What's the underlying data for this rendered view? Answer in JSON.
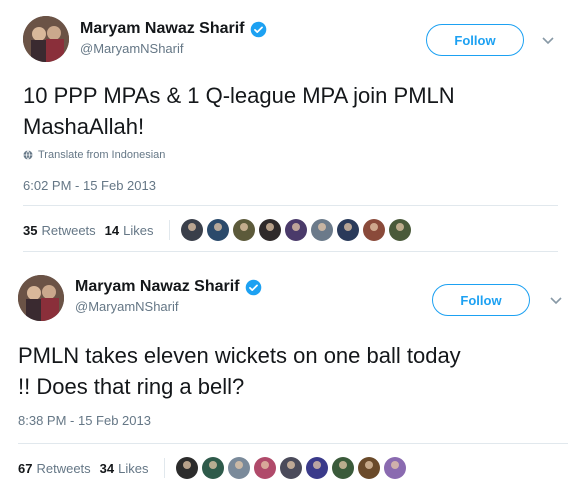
{
  "tweets": [
    {
      "author": {
        "name": "Maryam Nawaz Sharif",
        "handle": "@MaryamNSharif",
        "verified": true
      },
      "follow_label": "Follow",
      "text": "10 PPP MPAs & 1 Q-league MPA join PMLN\nMashaAllah!",
      "translate_label": "Translate from Indonesian",
      "timestamp": "6:02 PM - 15 Feb 2013",
      "retweets": {
        "count": "35",
        "label": "Retweets"
      },
      "likes": {
        "count": "14",
        "label": "Likes"
      },
      "liker_colors": [
        "#3a3f4a",
        "#2b4a6b",
        "#5c5a3a",
        "#2f2a2a",
        "#4a3a6a",
        "#6b7a8a",
        "#2a3a5a",
        "#8a4a3a",
        "#4a5a3a"
      ]
    },
    {
      "author": {
        "name": "Maryam Nawaz Sharif",
        "handle": "@MaryamNSharif",
        "verified": true
      },
      "follow_label": "Follow",
      "text": "PMLN takes eleven wickets on one ball today\n!! Does that ring a bell?",
      "timestamp": "8:38 PM - 15 Feb 2013",
      "retweets": {
        "count": "67",
        "label": "Retweets"
      },
      "likes": {
        "count": "34",
        "label": "Likes"
      },
      "liker_colors": [
        "#2c2c2c",
        "#2e5a4a",
        "#7a8a9a",
        "#b04a6a",
        "#4a4a5a",
        "#3a3a8a",
        "#3a5a3a",
        "#6a4a2a",
        "#8a6ab0"
      ]
    }
  ],
  "colors": {
    "accent": "#1da1f2",
    "muted": "#657786",
    "text": "#14171a",
    "divider": "#e1e8ed"
  },
  "icons": {
    "verified": "verified-badge-icon",
    "caret": "chevron-down-icon",
    "globe": "globe-icon"
  }
}
